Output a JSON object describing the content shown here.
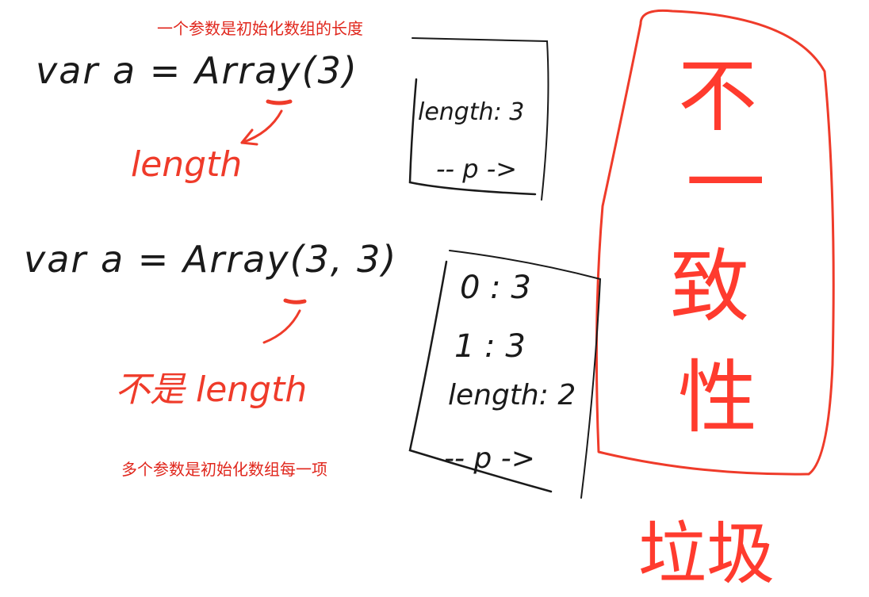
{
  "annotations": {
    "one_param_note": "一个参数是初始化数组的长度",
    "multi_param_note": "多个参数是初始化数组每一项"
  },
  "code": {
    "line1": "var a = Array(3)",
    "line2": "var a = Array(3, 3)"
  },
  "labels": {
    "length_red": "length",
    "not_length_red": "不是 length"
  },
  "box1": {
    "length_line": "length: 3",
    "proto_line": "-- p ->"
  },
  "box2": {
    "item0": "0 : 3",
    "item1": "1 : 3",
    "length_line": "length: 2",
    "proto_line": "-- p ->"
  },
  "big_chars": [
    "不",
    "一",
    "致",
    "性"
  ],
  "bottom_word": "垃圾",
  "colors": {
    "ink": "#1a1a1a",
    "red": "#ef3b2a",
    "typed_red": "#e0261c"
  }
}
